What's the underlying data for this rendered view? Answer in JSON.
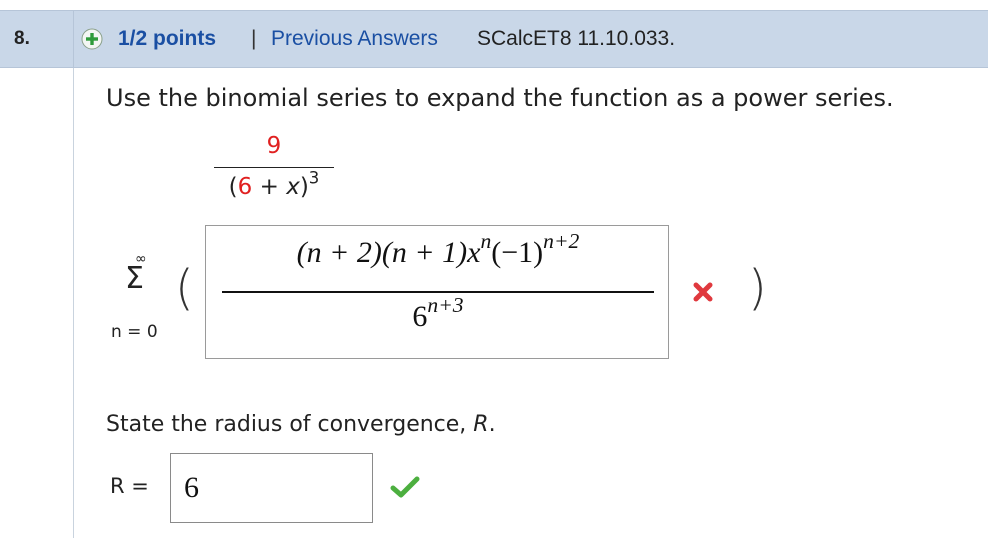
{
  "header": {
    "question_number": "8.",
    "points": "1/2 points",
    "separator": "|",
    "previous_answers": "Previous Answers",
    "problem_ref": "SCalcET8 11.10.033."
  },
  "prompt": "Use the binomial series to expand the function as a power series.",
  "function": {
    "numerator": "9",
    "den_open": "(",
    "den_six": "6",
    "den_plus": " + ",
    "den_x": "x",
    "den_close": ")",
    "den_exp": "3"
  },
  "sum": {
    "upper": "∞",
    "sigma": "Σ",
    "lower": "n = 0",
    "open_paren": "(",
    "close_paren": ")"
  },
  "answer1": {
    "num_main": "(n + 2)(n + 1)x",
    "num_exp1": "n",
    "num_mid": "(−1)",
    "num_exp2": "n+2",
    "den_base": "6",
    "den_exp": "n+3",
    "status": "incorrect"
  },
  "radius": {
    "prompt_text": "State the radius of convergence, ",
    "prompt_var": "R",
    "prompt_end": ".",
    "label": "R =",
    "value": "6",
    "status": "correct"
  },
  "colors": {
    "header_bg": "#c9d7e8",
    "link": "#1a4fa3",
    "highlight": "#e02020",
    "incorrect": "#e0393e",
    "correct": "#4caf3f"
  },
  "icons": [
    "plus-circle-icon",
    "incorrect-x-icon",
    "correct-check-icon"
  ]
}
